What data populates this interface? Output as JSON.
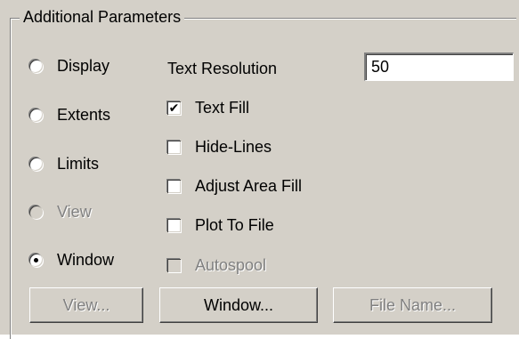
{
  "group": {
    "title": "Additional Parameters"
  },
  "radios": [
    {
      "label": "Display",
      "selected": false,
      "enabled": true
    },
    {
      "label": "Extents",
      "selected": false,
      "enabled": true
    },
    {
      "label": "Limits",
      "selected": false,
      "enabled": true
    },
    {
      "label": "View",
      "selected": false,
      "enabled": false
    },
    {
      "label": "Window",
      "selected": true,
      "enabled": true
    }
  ],
  "text_resolution": {
    "label": "Text Resolution",
    "value": "50"
  },
  "checks": [
    {
      "label": "Text Fill",
      "checked": true,
      "enabled": true
    },
    {
      "label": "Hide-Lines",
      "checked": false,
      "enabled": true
    },
    {
      "label": "Adjust Area Fill",
      "checked": false,
      "enabled": true
    },
    {
      "label": "Plot To File",
      "checked": false,
      "enabled": true
    },
    {
      "label": "Autospool",
      "checked": false,
      "enabled": false
    }
  ],
  "buttons": {
    "view": {
      "label": "View...",
      "enabled": false
    },
    "window": {
      "label": "Window...",
      "enabled": true
    },
    "file_name": {
      "label": "File Name...",
      "enabled": false
    }
  },
  "check_glyph": "✔"
}
